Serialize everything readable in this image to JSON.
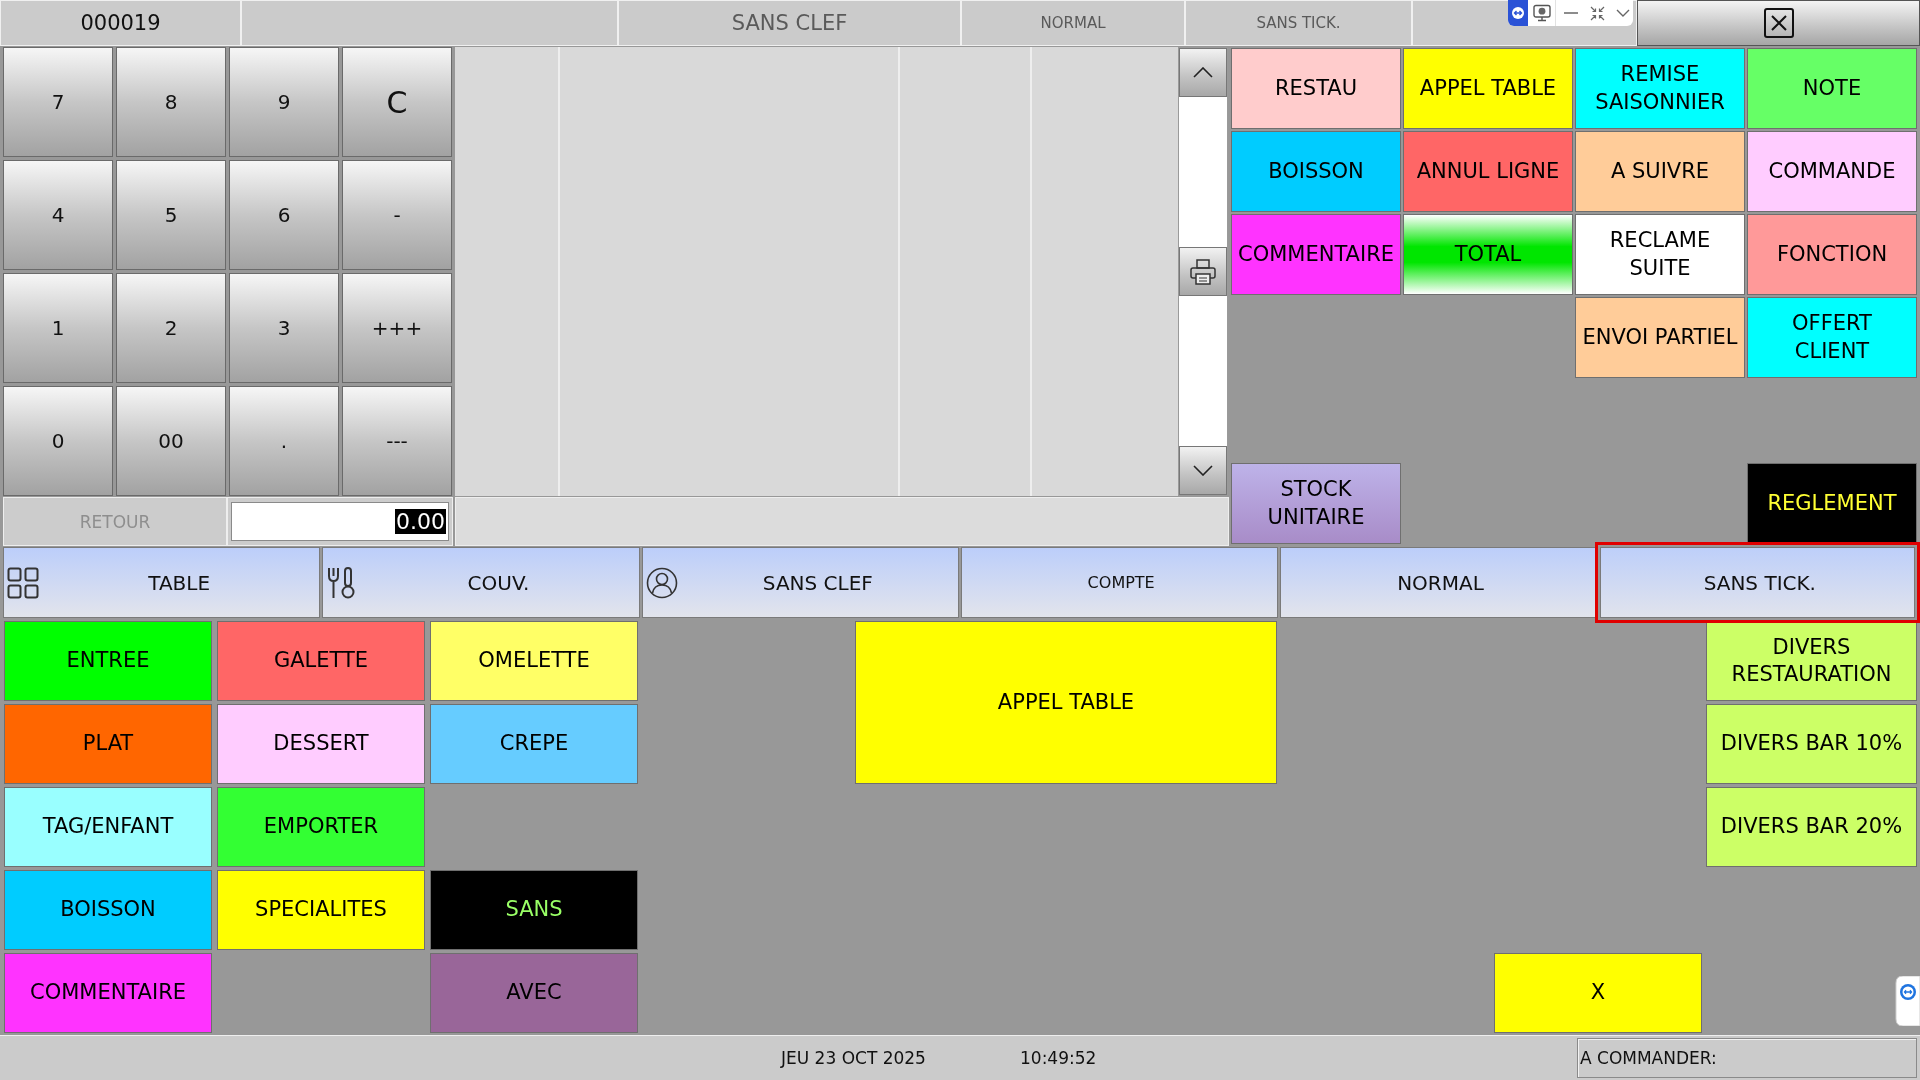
{
  "header": {
    "ticket_number": "000019",
    "fields": [
      "SANS CLEF",
      "NORMAL",
      "SANS TICK."
    ]
  },
  "keypad": {
    "keys": [
      "7",
      "8",
      "9",
      "C",
      "4",
      "5",
      "6",
      "-",
      "1",
      "2",
      "3",
      "+++",
      "0",
      "00",
      ".",
      "---"
    ],
    "return_button": {
      "label": "RETOUR",
      "disabled": true
    },
    "amount": {
      "value": "0.00",
      "highlighted": true
    }
  },
  "function_buttons": [
    {
      "label": "RESTAU",
      "color": "#ffcccc",
      "kind": "flat"
    },
    {
      "label": "APPEL TABLE",
      "color": "#ffff00",
      "kind": "flat"
    },
    {
      "label": "REMISE SAISONNIER",
      "color": "#00ffff",
      "kind": "flat"
    },
    {
      "label": "NOTE",
      "color": "#66ff66",
      "kind": "flat"
    },
    {
      "label": "BOISSON",
      "color": "#00ccff",
      "kind": "flat"
    },
    {
      "label": "ANNUL LIGNE",
      "color": "#ff6666",
      "kind": "flat"
    },
    {
      "label": "A SUIVRE",
      "color": "#ffcc99",
      "kind": "flat"
    },
    {
      "label": "COMMANDE",
      "color": "#ffccff",
      "kind": "flat"
    },
    {
      "label": "COMMENTAIRE",
      "color": "#ff33ff",
      "kind": "flat"
    },
    {
      "label": "TOTAL",
      "color": "#00e600",
      "kind": "glow"
    },
    {
      "label": "RECLAME SUITE",
      "color": "#ffffff",
      "kind": "flat"
    },
    {
      "label": "FONCTION",
      "color": "#ff9999",
      "kind": "flat"
    },
    {
      "label": "ENVOI PARTIEL",
      "color": "#ffcc99",
      "kind": "flat"
    },
    {
      "label": "OFFERT CLIENT",
      "color": "#00ffff",
      "kind": "flat"
    },
    {
      "label": "STOCK UNITAIRE",
      "color": "#a88cc8",
      "kind": "shade"
    },
    {
      "label": "REGLEMENT",
      "color": "#000000",
      "kind": "dark"
    }
  ],
  "toolbar": [
    {
      "label": "TABLE",
      "selected": false
    },
    {
      "label": "COUV.",
      "selected": false
    },
    {
      "label": "SANS CLEF",
      "selected": false
    },
    {
      "label": "COMPTE",
      "selected": false
    },
    {
      "label": "NORMAL",
      "selected": false
    },
    {
      "label": "SANS TICK.",
      "selected": true
    }
  ],
  "menu": {
    "categories": [
      {
        "label": "ENTREE",
        "color": "#00ff00",
        "kind": "flat"
      },
      {
        "label": "GALETTE",
        "color": "#ff6666",
        "kind": "flat"
      },
      {
        "label": "OMELETTE",
        "color": "#ffff66",
        "kind": "flat"
      },
      {
        "label": "PLAT",
        "color": "#ff6600",
        "kind": "flat"
      },
      {
        "label": "DESSERT",
        "color": "#ffccff",
        "kind": "flat"
      },
      {
        "label": "CREPE",
        "color": "#66ccff",
        "kind": "flat"
      },
      {
        "label": "TAG/ENFANT",
        "color": "#99ffff",
        "kind": "flat"
      },
      {
        "label": "EMPORTER",
        "color": "#33ff33",
        "kind": "flat"
      },
      {
        "label": "BOISSON",
        "color": "#00ccff",
        "kind": "flat"
      },
      {
        "label": "SPECIALITES",
        "color": "#ffff00",
        "kind": "flat"
      },
      {
        "label": "SANS",
        "color": "#000000",
        "kind": "dark"
      },
      {
        "label": "COMMENTAIRE",
        "color": "#ff33ff",
        "kind": "flat"
      },
      {
        "label": "AVEC",
        "color": "#996699",
        "kind": "flat"
      }
    ],
    "call_button": {
      "label": "APPEL TABLE"
    },
    "misc_items": [
      {
        "label": "DIVERS RESTAURATION"
      },
      {
        "label": "DIVERS BAR 10%"
      },
      {
        "label": "DIVERS BAR 20%"
      }
    ],
    "cancel_button": {
      "label": "X"
    }
  },
  "status_bar": {
    "date": "JEU 23 OCT 2025",
    "time": "10:49:52",
    "to_order_label": "A COMMANDER:"
  }
}
